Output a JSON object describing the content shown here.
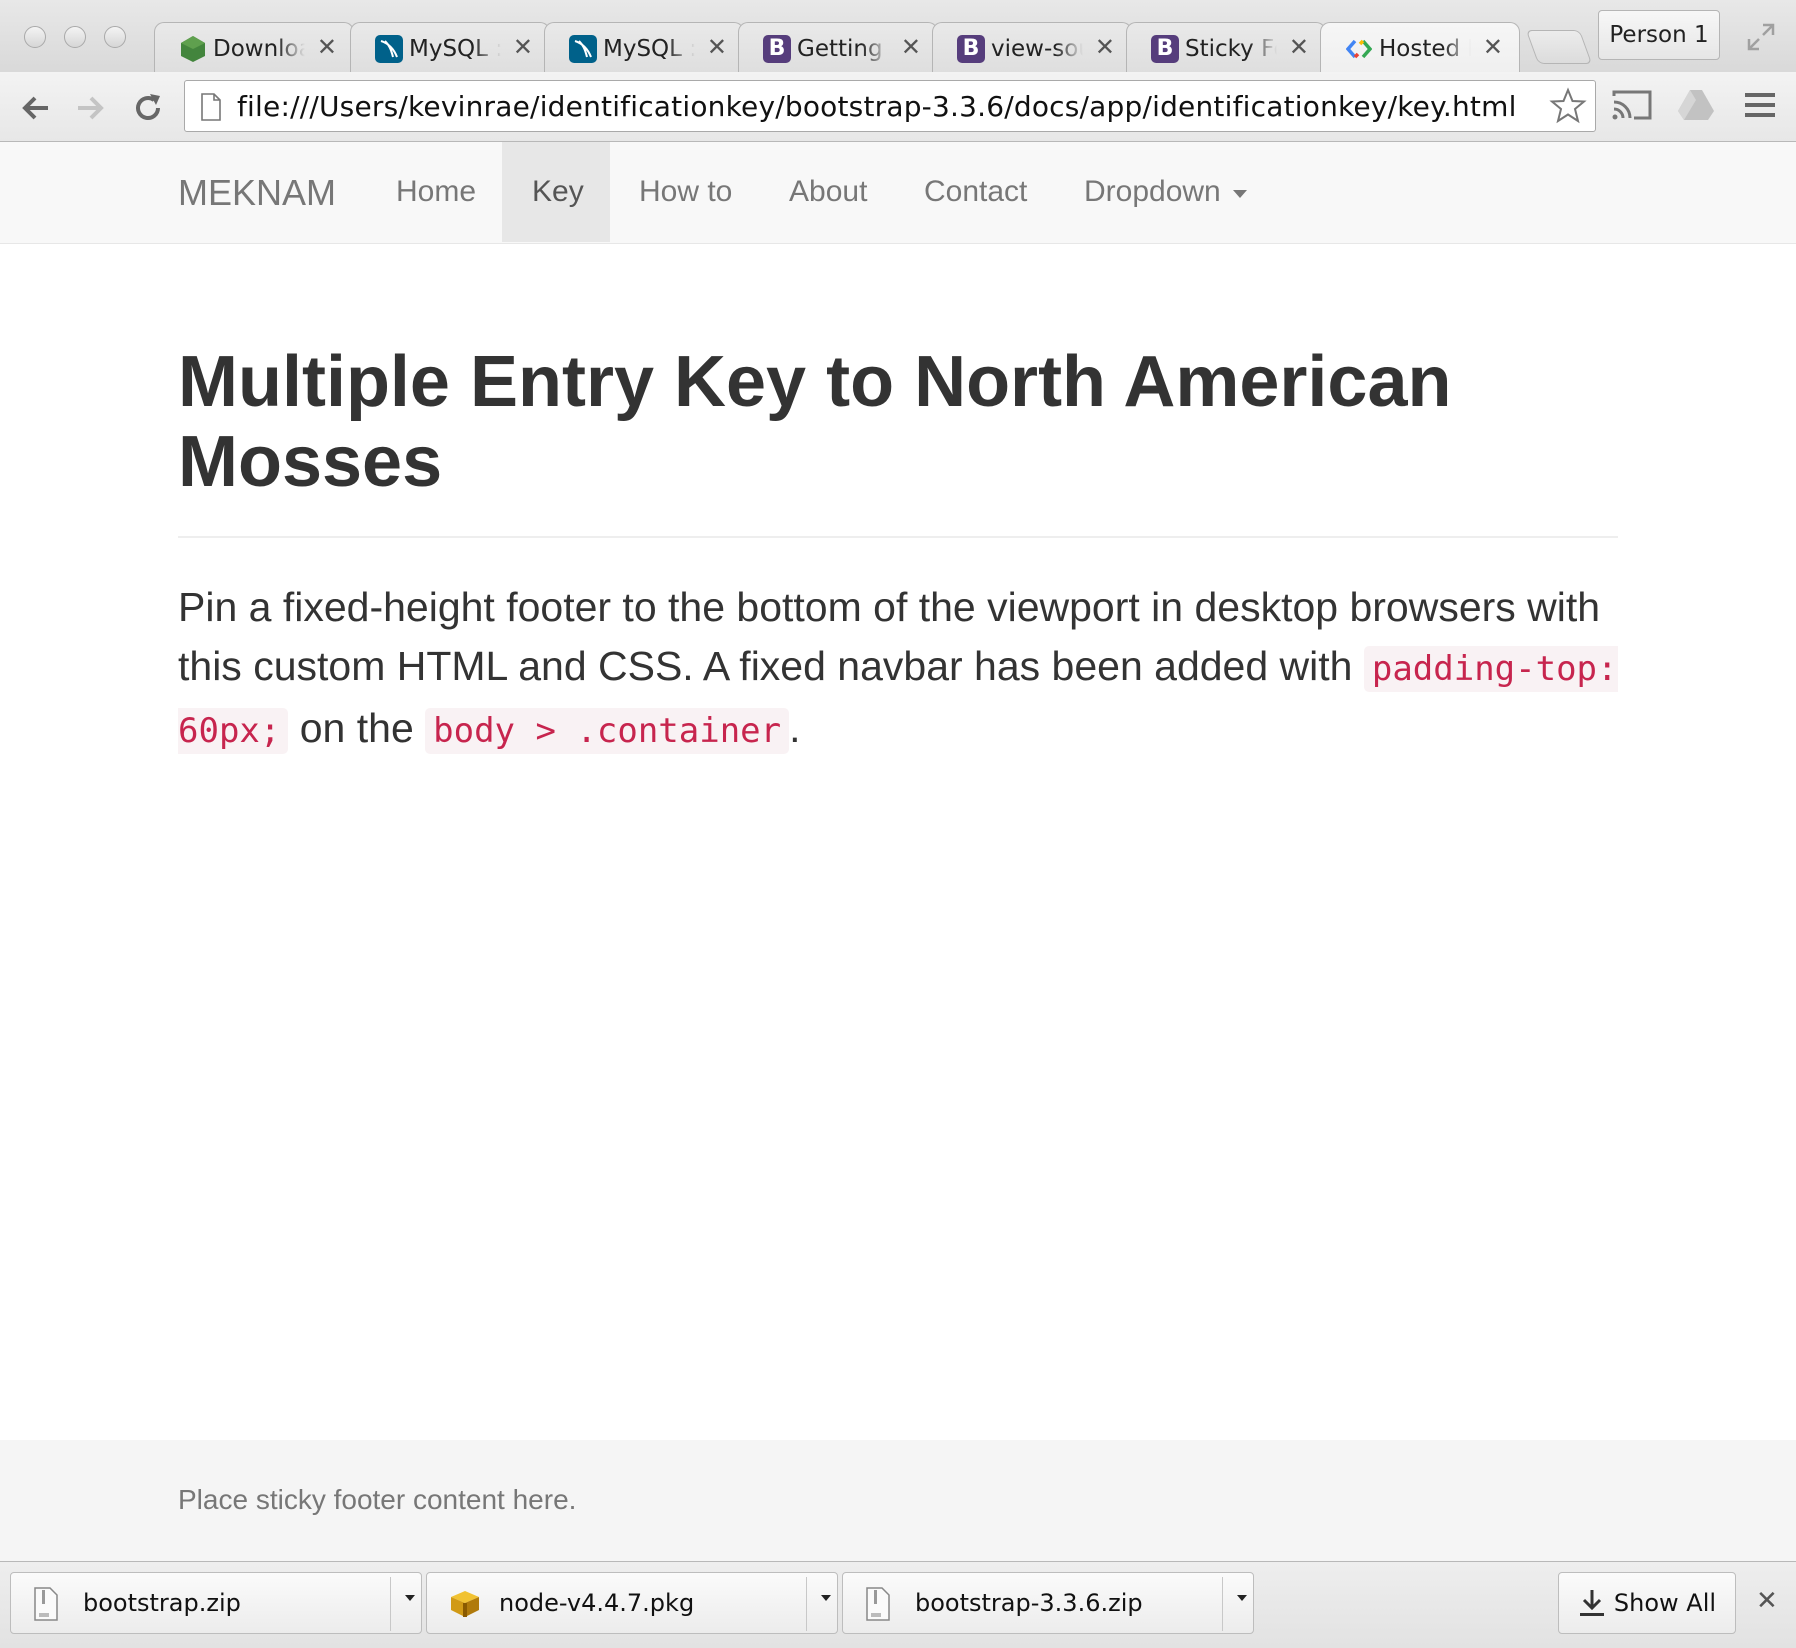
{
  "browser": {
    "tabs": [
      {
        "title": "Download",
        "favicon": "nodejs-hexagon-icon",
        "color": "#43853d"
      },
      {
        "title": "MySQL :: ",
        "favicon": "mysql-dolphin-icon",
        "color": "#00618a"
      },
      {
        "title": "MySQL :: ",
        "favicon": "mysql-dolphin-icon",
        "color": "#00618a"
      },
      {
        "title": "Getting started",
        "favicon": "bootstrap-b-icon",
        "color": "#563d7c"
      },
      {
        "title": "view-source",
        "favicon": "bootstrap-b-icon",
        "color": "#563d7c"
      },
      {
        "title": "Sticky Footer",
        "favicon": "bootstrap-b-icon",
        "color": "#563d7c"
      },
      {
        "title": "Hosted Libraries",
        "favicon": "google-developers-icon",
        "color": "#ffffff"
      }
    ],
    "tab_close_glyph": "✕",
    "profile_label": "Person 1",
    "url": "file:///Users/kevinrae/identificationkey/bootstrap-3.3.6/docs/app/identificationkey/key.html"
  },
  "navbar": {
    "brand": "MEKNAM",
    "items": [
      {
        "label": "Home",
        "active": false
      },
      {
        "label": "Key",
        "active": true
      },
      {
        "label": "How to",
        "active": false
      },
      {
        "label": "About",
        "active": false
      },
      {
        "label": "Contact",
        "active": false
      },
      {
        "label": "Dropdown",
        "active": false
      }
    ]
  },
  "main": {
    "title": "Multiple Entry Key to North American Mosses",
    "lead_part1": "Pin a fixed-height footer to the bottom of the viewport in desktop browsers with this custom HTML and CSS. A fixed navbar has been added with ",
    "lead_code1": "padding-top: 60px;",
    "lead_part2": " on the ",
    "lead_code2": "body > .container",
    "lead_part3": "."
  },
  "footer": {
    "text": "Place sticky footer content here."
  },
  "downloads": {
    "items": [
      {
        "name": "bootstrap.zip",
        "icon": "zip-file-icon"
      },
      {
        "name": "node-v4.4.7.pkg",
        "icon": "package-box-icon"
      },
      {
        "name": "bootstrap-3.3.6.zip",
        "icon": "zip-file-icon"
      }
    ],
    "show_all_label": "Show All",
    "close_glyph": "✕"
  },
  "colors": {
    "code_text": "#c7254e",
    "code_bg": "#f9f2f4",
    "navbar_bg": "#f8f8f8",
    "active_nav_bg": "#e7e7e7",
    "footer_bg": "#f5f5f5"
  }
}
